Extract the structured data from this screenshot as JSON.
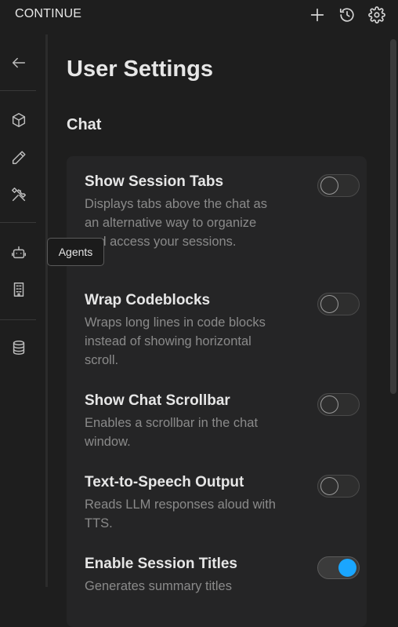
{
  "header": {
    "app_title": "CONTINUE",
    "icons": [
      "plus-icon",
      "history-icon",
      "gear-icon"
    ]
  },
  "sidebar": {
    "items": [
      "back-arrow-icon",
      "cube-icon",
      "pencil-icon",
      "tools-icon",
      "robot-icon",
      "building-icon",
      "database-icon"
    ],
    "tooltip": "Agents"
  },
  "main": {
    "page_title": "User Settings",
    "section_title": "Chat",
    "settings": [
      {
        "label": "Show Session Tabs",
        "description": "Displays tabs above the chat as an alternative way to organize and access your sessions.",
        "enabled": false
      },
      {
        "label": "Wrap Codeblocks",
        "description": "Wraps long lines in code blocks instead of showing horizontal scroll.",
        "enabled": false
      },
      {
        "label": "Show Chat Scrollbar",
        "description": "Enables a scrollbar in the chat window.",
        "enabled": false
      },
      {
        "label": "Text-to-Speech Output",
        "description": "Reads LLM responses aloud with TTS.",
        "enabled": false
      },
      {
        "label": "Enable Session Titles",
        "description": "Generates summary titles",
        "enabled": true
      }
    ]
  },
  "colors": {
    "accent": "#1aa6ff",
    "background": "#1e1e1e",
    "card": "#252526"
  }
}
